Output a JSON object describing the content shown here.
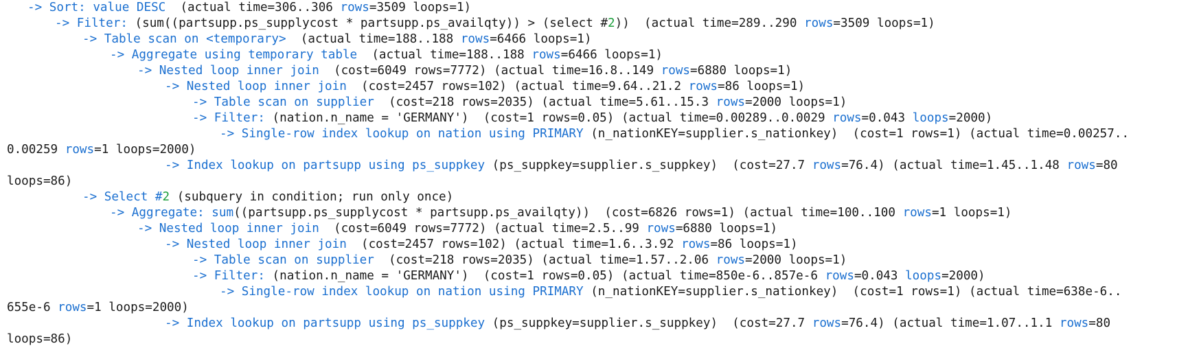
{
  "colors": {
    "keyword": "#1a6fd0",
    "text": "#1a1a1a",
    "select_number": "#1a9e3a",
    "background": "#ffffff"
  },
  "lines": [
    {
      "indent": 0,
      "segs": [
        [
          "k",
          "-> Sort: value DESC"
        ],
        [
          "t",
          "  (actual time=306..306 "
        ],
        [
          "k",
          "rows"
        ],
        [
          "t",
          "=3509 loops=1)"
        ]
      ]
    },
    {
      "indent": 1,
      "segs": [
        [
          "k",
          "-> Filter: "
        ],
        [
          "t",
          "(sum((partsupp.ps_supplycost * partsupp.ps_availqty)) > (select #"
        ],
        [
          "n",
          "2"
        ],
        [
          "t",
          "))  (actual time=289..290 "
        ],
        [
          "k",
          "rows"
        ],
        [
          "t",
          "=3509 loops=1)"
        ]
      ]
    },
    {
      "indent": 2,
      "segs": [
        [
          "k",
          "-> Table scan on <temporary>"
        ],
        [
          "t",
          "  (actual time=188..188 "
        ],
        [
          "k",
          "rows"
        ],
        [
          "t",
          "=6466 loops=1)"
        ]
      ]
    },
    {
      "indent": 3,
      "segs": [
        [
          "k",
          "-> Aggregate using temporary table"
        ],
        [
          "t",
          "  (actual time=188..188 "
        ],
        [
          "k",
          "rows"
        ],
        [
          "t",
          "=6466 loops=1)"
        ]
      ]
    },
    {
      "indent": 4,
      "segs": [
        [
          "k",
          "-> Nested loop inner join"
        ],
        [
          "t",
          "  (cost=6049 rows=7772) (actual time=16.8..149 "
        ],
        [
          "k",
          "rows"
        ],
        [
          "t",
          "=6880 loops=1)"
        ]
      ]
    },
    {
      "indent": 5,
      "segs": [
        [
          "k",
          "-> Nested loop inner join"
        ],
        [
          "t",
          "  (cost=2457 rows=102) (actual time=9.64..21.2 "
        ],
        [
          "k",
          "rows"
        ],
        [
          "t",
          "=86 loops=1)"
        ]
      ]
    },
    {
      "indent": 6,
      "segs": [
        [
          "k",
          "-> Table scan on supplier"
        ],
        [
          "t",
          "  (cost=218 rows=2035) (actual time=5.61..15.3 "
        ],
        [
          "k",
          "rows"
        ],
        [
          "t",
          "=2000 loops=1)"
        ]
      ]
    },
    {
      "indent": 6,
      "segs": [
        [
          "k",
          "-> Filter: "
        ],
        [
          "t",
          "(nation.n_name = 'GERMANY')  (cost=1 rows=0.05) (actual time=0.00289..0.0029 "
        ],
        [
          "k",
          "rows"
        ],
        [
          "t",
          "=0.043 "
        ],
        [
          "k",
          "loops"
        ],
        [
          "t",
          "=2000)"
        ]
      ]
    },
    {
      "indent": 7,
      "segs": [
        [
          "k",
          "-> Single-row index lookup on nation using PRIMARY"
        ],
        [
          "t",
          " (n_nationKEY=supplier.s_nationkey)  (cost=1 rows=1) (actual time=0.00257.."
        ]
      ]
    },
    {
      "indent": -1,
      "segs": [
        [
          "t",
          "0.00259 "
        ],
        [
          "k",
          "rows"
        ],
        [
          "t",
          "=1 loops=2000)"
        ]
      ]
    },
    {
      "indent": 5,
      "segs": [
        [
          "k",
          "-> Index lookup on partsupp using ps_suppkey"
        ],
        [
          "t",
          " (ps_suppkey=supplier.s_suppkey)  (cost=27.7 "
        ],
        [
          "k",
          "rows"
        ],
        [
          "t",
          "=76.4) (actual time=1.45..1.48 "
        ],
        [
          "k",
          "rows"
        ],
        [
          "t",
          "=80"
        ]
      ]
    },
    {
      "indent": -1,
      "segs": [
        [
          "t",
          "loops=86)"
        ]
      ]
    },
    {
      "indent": 2,
      "segs": [
        [
          "k",
          "-> Select #"
        ],
        [
          "n",
          "2"
        ],
        [
          "t",
          " (subquery in condition; run only once)"
        ]
      ]
    },
    {
      "indent": 3,
      "segs": [
        [
          "k",
          "-> Aggregate: sum"
        ],
        [
          "t",
          "((partsupp.ps_supplycost * partsupp.ps_availqty))  (cost=6826 rows=1) (actual time=100..100 "
        ],
        [
          "k",
          "rows"
        ],
        [
          "t",
          "=1 loops=1)"
        ]
      ]
    },
    {
      "indent": 4,
      "segs": [
        [
          "k",
          "-> Nested loop inner join"
        ],
        [
          "t",
          "  (cost=6049 rows=7772) (actual time=2.5..99 "
        ],
        [
          "k",
          "rows"
        ],
        [
          "t",
          "=6880 loops=1)"
        ]
      ]
    },
    {
      "indent": 5,
      "segs": [
        [
          "k",
          "-> Nested loop inner join"
        ],
        [
          "t",
          "  (cost=2457 rows=102) (actual time=1.6..3.92 "
        ],
        [
          "k",
          "rows"
        ],
        [
          "t",
          "=86 loops=1)"
        ]
      ]
    },
    {
      "indent": 6,
      "segs": [
        [
          "k",
          "-> Table scan on supplier"
        ],
        [
          "t",
          "  (cost=218 rows=2035) (actual time=1.57..2.06 "
        ],
        [
          "k",
          "rows"
        ],
        [
          "t",
          "=2000 loops=1)"
        ]
      ]
    },
    {
      "indent": 6,
      "segs": [
        [
          "k",
          "-> Filter: "
        ],
        [
          "t",
          "(nation.n_name = 'GERMANY')  (cost=1 rows=0.05) (actual time=850e-6..857e-6 "
        ],
        [
          "k",
          "rows"
        ],
        [
          "t",
          "=0.043 "
        ],
        [
          "k",
          "loops"
        ],
        [
          "t",
          "=2000)"
        ]
      ]
    },
    {
      "indent": 7,
      "segs": [
        [
          "k",
          "-> Single-row index lookup on nation using PRIMARY"
        ],
        [
          "t",
          " (n_nationKEY=supplier.s_nationkey)  (cost=1 rows=1) (actual time=638e-6.."
        ]
      ]
    },
    {
      "indent": -1,
      "segs": [
        [
          "t",
          "655e-6 "
        ],
        [
          "k",
          "rows"
        ],
        [
          "t",
          "=1 loops=2000)"
        ]
      ]
    },
    {
      "indent": 5,
      "segs": [
        [
          "k",
          "-> Index lookup on partsupp using ps_suppkey"
        ],
        [
          "t",
          " (ps_suppkey=supplier.s_suppkey)  (cost=27.7 "
        ],
        [
          "k",
          "rows"
        ],
        [
          "t",
          "=76.4) (actual time=1.07..1.1 "
        ],
        [
          "k",
          "rows"
        ],
        [
          "t",
          "=80"
        ]
      ]
    },
    {
      "indent": -1,
      "segs": [
        [
          "t",
          "loops=86)"
        ]
      ]
    }
  ]
}
